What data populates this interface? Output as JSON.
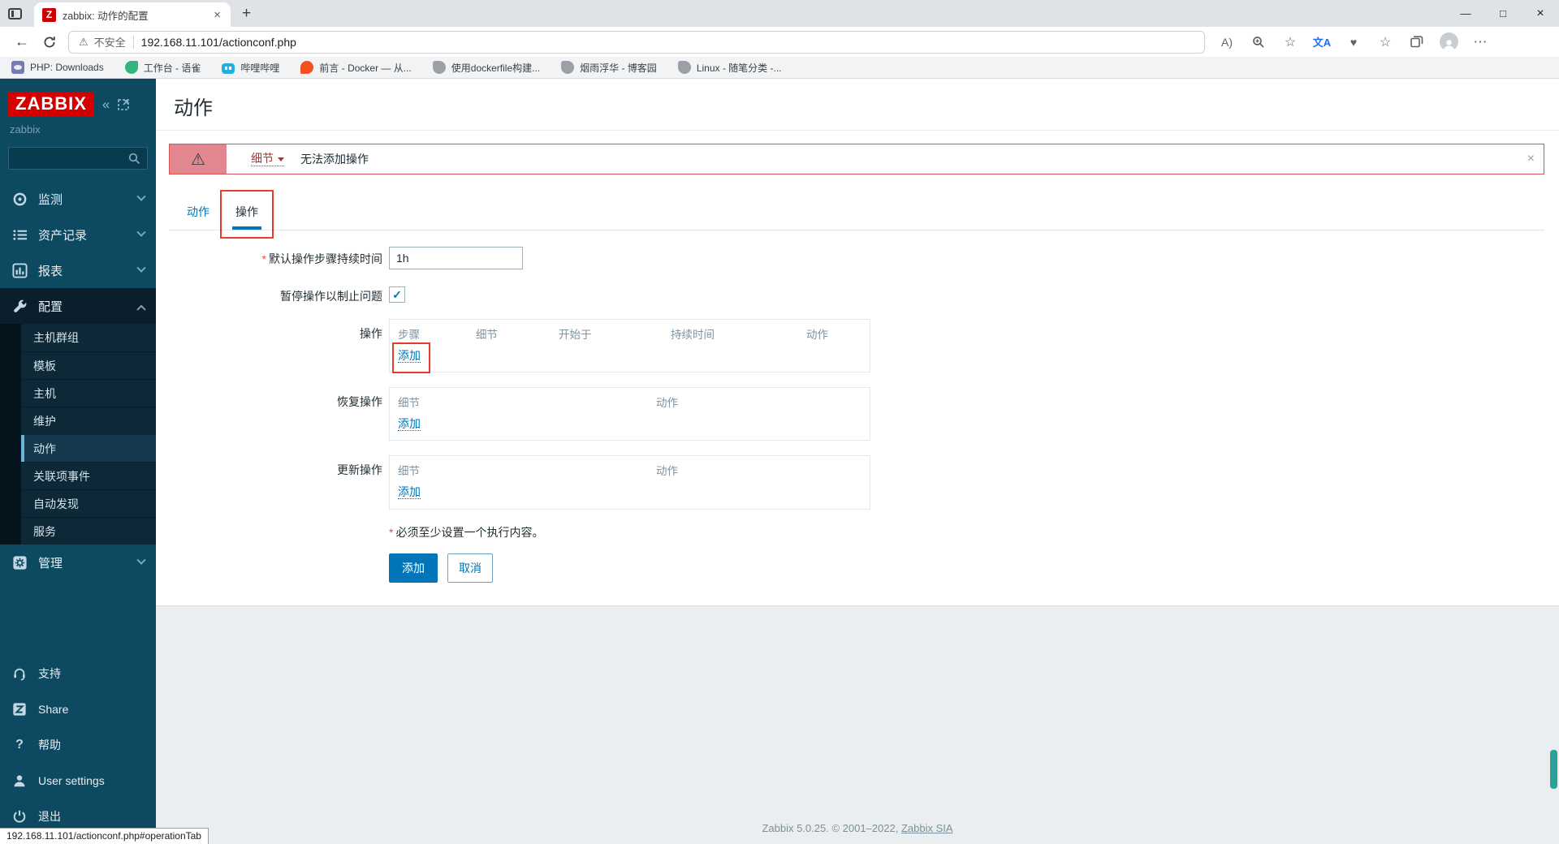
{
  "colors": {
    "accent_blue": "#0275b8",
    "error_red": "#d9534f",
    "error_block_pink": "#e2868f",
    "logo_red": "#d40000",
    "sidebar_teal": "#0e4962",
    "annotation_red": "#e33b2c",
    "scroll_thumb_teal": "#2aa198"
  },
  "browser": {
    "tab": {
      "title": "zabbix: 动作的配置",
      "close_glyph": "×"
    },
    "new_tab_glyph": "+",
    "window_controls": {
      "minimize": "—",
      "maximize": "□",
      "close": "×"
    },
    "address": {
      "security_glyph": "⚠",
      "security_label": "不安全",
      "url": "192.168.11.101/actionconf.php"
    },
    "glyphs": {
      "back": "←",
      "read_aloud": "A)",
      "star": "☆",
      "heart": "♥",
      "translate": "文A",
      "more": "⋯"
    },
    "bookmarks": [
      {
        "label": "PHP: Downloads"
      },
      {
        "label": "工作台 - 语雀"
      },
      {
        "label": "哔哩哔哩"
      },
      {
        "label": "前言 - Docker — 从..."
      },
      {
        "label": "使用dockerfile构建..."
      },
      {
        "label": "烟雨浮华 - 博客园"
      },
      {
        "label": "Linux - 随笔分类 -..."
      }
    ],
    "status_bubble": "192.168.11.101/actionconf.php#operationTab"
  },
  "sidebar": {
    "logo": "ZABBIX",
    "collapse_glyph": "«",
    "server_name": "zabbix",
    "menu": [
      {
        "label": "监测"
      },
      {
        "label": "资产记录"
      },
      {
        "label": "报表"
      },
      {
        "label": "配置"
      },
      {
        "label": "管理"
      }
    ],
    "submenu": [
      {
        "label": "主机群组"
      },
      {
        "label": "模板"
      },
      {
        "label": "主机"
      },
      {
        "label": "维护"
      },
      {
        "label": "动作",
        "active": true
      },
      {
        "label": "关联项事件"
      },
      {
        "label": "自动发现"
      },
      {
        "label": "服务"
      }
    ],
    "footer_menu": [
      {
        "label": "支持"
      },
      {
        "label": "Share"
      },
      {
        "label": "帮助",
        "help_glyph": "?"
      },
      {
        "label": "User settings"
      },
      {
        "label": "退出"
      }
    ]
  },
  "page": {
    "title": "动作",
    "error": {
      "warning_glyph": "⚠",
      "details_label": "细节",
      "message": "无法添加操作",
      "close_glyph": "×"
    },
    "tabs": [
      {
        "label": "动作"
      },
      {
        "label": "操作",
        "active": true
      }
    ],
    "form": {
      "duration": {
        "required": "*",
        "label": "默认操作步骤持续时间",
        "value": "1h"
      },
      "pause": {
        "label": "暂停操作以制止问题",
        "checked_glyph": "✓"
      },
      "operations": {
        "label": "操作",
        "headers": [
          "步骤",
          "细节",
          "开始于",
          "持续时间",
          "动作"
        ],
        "add_label": "添加"
      },
      "recovery": {
        "label": "恢复操作",
        "headers": [
          "细节",
          "动作"
        ],
        "add_label": "添加"
      },
      "update": {
        "label": "更新操作",
        "headers": [
          "细节",
          "动作"
        ],
        "add_label": "添加"
      },
      "required_note": {
        "asterisk": "*",
        "text": "必须至少设置一个执行内容。"
      },
      "buttons": {
        "submit": "添加",
        "cancel": "取消"
      }
    },
    "footer": {
      "text": "Zabbix 5.0.25. © 2001–2022, ",
      "link": "Zabbix SIA"
    }
  }
}
